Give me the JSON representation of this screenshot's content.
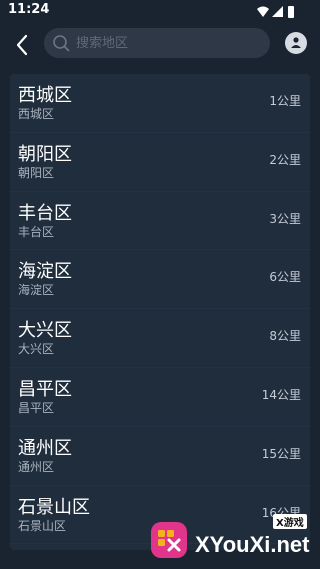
{
  "status_bar": {
    "time": "11:24"
  },
  "search": {
    "placeholder": "搜索地区"
  },
  "districts": [
    {
      "name": "西城区",
      "sub": "西城区",
      "distance": "1公里"
    },
    {
      "name": "朝阳区",
      "sub": "朝阳区",
      "distance": "2公里"
    },
    {
      "name": "丰台区",
      "sub": "丰台区",
      "distance": "3公里"
    },
    {
      "name": "海淀区",
      "sub": "海淀区",
      "distance": "6公里"
    },
    {
      "name": "大兴区",
      "sub": "大兴区",
      "distance": "8公里"
    },
    {
      "name": "昌平区",
      "sub": "昌平区",
      "distance": "14公里"
    },
    {
      "name": "通州区",
      "sub": "通州区",
      "distance": "15公里"
    },
    {
      "name": "石景山区",
      "sub": "石景山区",
      "distance": "16公里"
    }
  ],
  "watermark": {
    "text": "XYouXi.net",
    "badge": "X游戏"
  },
  "icons": {
    "wifi": "wifi-icon",
    "signal": "signal-icon",
    "battery": "battery-icon",
    "back": "back-arrow-icon",
    "search": "search-icon",
    "locate": "location-person-icon"
  },
  "colors": {
    "background": "#1a2431",
    "list_bg": "#202d3c",
    "search_bg": "#2e3846"
  }
}
